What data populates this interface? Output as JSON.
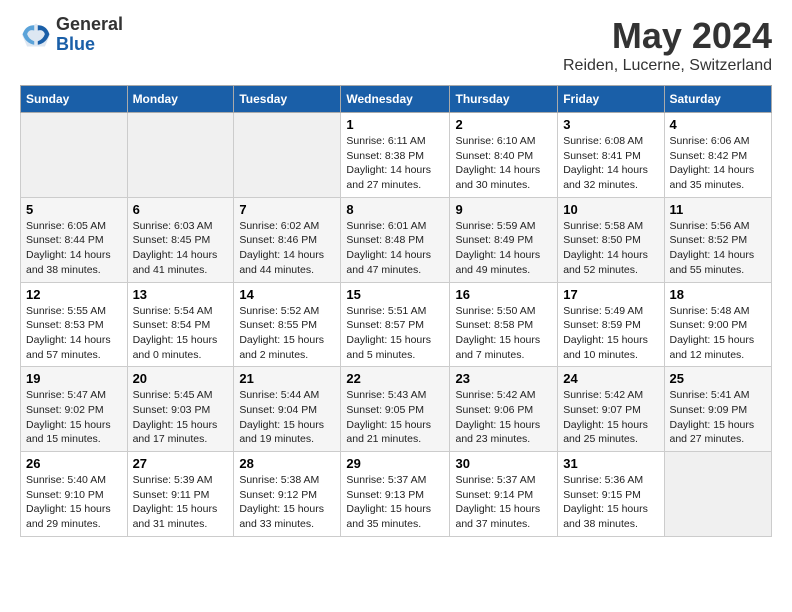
{
  "logo": {
    "general": "General",
    "blue": "Blue"
  },
  "title": "May 2024",
  "subtitle": "Reiden, Lucerne, Switzerland",
  "days_of_week": [
    "Sunday",
    "Monday",
    "Tuesday",
    "Wednesday",
    "Thursday",
    "Friday",
    "Saturday"
  ],
  "weeks": [
    [
      {
        "num": "",
        "info": ""
      },
      {
        "num": "",
        "info": ""
      },
      {
        "num": "",
        "info": ""
      },
      {
        "num": "1",
        "info": "Sunrise: 6:11 AM\nSunset: 8:38 PM\nDaylight: 14 hours\nand 27 minutes."
      },
      {
        "num": "2",
        "info": "Sunrise: 6:10 AM\nSunset: 8:40 PM\nDaylight: 14 hours\nand 30 minutes."
      },
      {
        "num": "3",
        "info": "Sunrise: 6:08 AM\nSunset: 8:41 PM\nDaylight: 14 hours\nand 32 minutes."
      },
      {
        "num": "4",
        "info": "Sunrise: 6:06 AM\nSunset: 8:42 PM\nDaylight: 14 hours\nand 35 minutes."
      }
    ],
    [
      {
        "num": "5",
        "info": "Sunrise: 6:05 AM\nSunset: 8:44 PM\nDaylight: 14 hours\nand 38 minutes."
      },
      {
        "num": "6",
        "info": "Sunrise: 6:03 AM\nSunset: 8:45 PM\nDaylight: 14 hours\nand 41 minutes."
      },
      {
        "num": "7",
        "info": "Sunrise: 6:02 AM\nSunset: 8:46 PM\nDaylight: 14 hours\nand 44 minutes."
      },
      {
        "num": "8",
        "info": "Sunrise: 6:01 AM\nSunset: 8:48 PM\nDaylight: 14 hours\nand 47 minutes."
      },
      {
        "num": "9",
        "info": "Sunrise: 5:59 AM\nSunset: 8:49 PM\nDaylight: 14 hours\nand 49 minutes."
      },
      {
        "num": "10",
        "info": "Sunrise: 5:58 AM\nSunset: 8:50 PM\nDaylight: 14 hours\nand 52 minutes."
      },
      {
        "num": "11",
        "info": "Sunrise: 5:56 AM\nSunset: 8:52 PM\nDaylight: 14 hours\nand 55 minutes."
      }
    ],
    [
      {
        "num": "12",
        "info": "Sunrise: 5:55 AM\nSunset: 8:53 PM\nDaylight: 14 hours\nand 57 minutes."
      },
      {
        "num": "13",
        "info": "Sunrise: 5:54 AM\nSunset: 8:54 PM\nDaylight: 15 hours\nand 0 minutes."
      },
      {
        "num": "14",
        "info": "Sunrise: 5:52 AM\nSunset: 8:55 PM\nDaylight: 15 hours\nand 2 minutes."
      },
      {
        "num": "15",
        "info": "Sunrise: 5:51 AM\nSunset: 8:57 PM\nDaylight: 15 hours\nand 5 minutes."
      },
      {
        "num": "16",
        "info": "Sunrise: 5:50 AM\nSunset: 8:58 PM\nDaylight: 15 hours\nand 7 minutes."
      },
      {
        "num": "17",
        "info": "Sunrise: 5:49 AM\nSunset: 8:59 PM\nDaylight: 15 hours\nand 10 minutes."
      },
      {
        "num": "18",
        "info": "Sunrise: 5:48 AM\nSunset: 9:00 PM\nDaylight: 15 hours\nand 12 minutes."
      }
    ],
    [
      {
        "num": "19",
        "info": "Sunrise: 5:47 AM\nSunset: 9:02 PM\nDaylight: 15 hours\nand 15 minutes."
      },
      {
        "num": "20",
        "info": "Sunrise: 5:45 AM\nSunset: 9:03 PM\nDaylight: 15 hours\nand 17 minutes."
      },
      {
        "num": "21",
        "info": "Sunrise: 5:44 AM\nSunset: 9:04 PM\nDaylight: 15 hours\nand 19 minutes."
      },
      {
        "num": "22",
        "info": "Sunrise: 5:43 AM\nSunset: 9:05 PM\nDaylight: 15 hours\nand 21 minutes."
      },
      {
        "num": "23",
        "info": "Sunrise: 5:42 AM\nSunset: 9:06 PM\nDaylight: 15 hours\nand 23 minutes."
      },
      {
        "num": "24",
        "info": "Sunrise: 5:42 AM\nSunset: 9:07 PM\nDaylight: 15 hours\nand 25 minutes."
      },
      {
        "num": "25",
        "info": "Sunrise: 5:41 AM\nSunset: 9:09 PM\nDaylight: 15 hours\nand 27 minutes."
      }
    ],
    [
      {
        "num": "26",
        "info": "Sunrise: 5:40 AM\nSunset: 9:10 PM\nDaylight: 15 hours\nand 29 minutes."
      },
      {
        "num": "27",
        "info": "Sunrise: 5:39 AM\nSunset: 9:11 PM\nDaylight: 15 hours\nand 31 minutes."
      },
      {
        "num": "28",
        "info": "Sunrise: 5:38 AM\nSunset: 9:12 PM\nDaylight: 15 hours\nand 33 minutes."
      },
      {
        "num": "29",
        "info": "Sunrise: 5:37 AM\nSunset: 9:13 PM\nDaylight: 15 hours\nand 35 minutes."
      },
      {
        "num": "30",
        "info": "Sunrise: 5:37 AM\nSunset: 9:14 PM\nDaylight: 15 hours\nand 37 minutes."
      },
      {
        "num": "31",
        "info": "Sunrise: 5:36 AM\nSunset: 9:15 PM\nDaylight: 15 hours\nand 38 minutes."
      },
      {
        "num": "",
        "info": ""
      }
    ]
  ]
}
